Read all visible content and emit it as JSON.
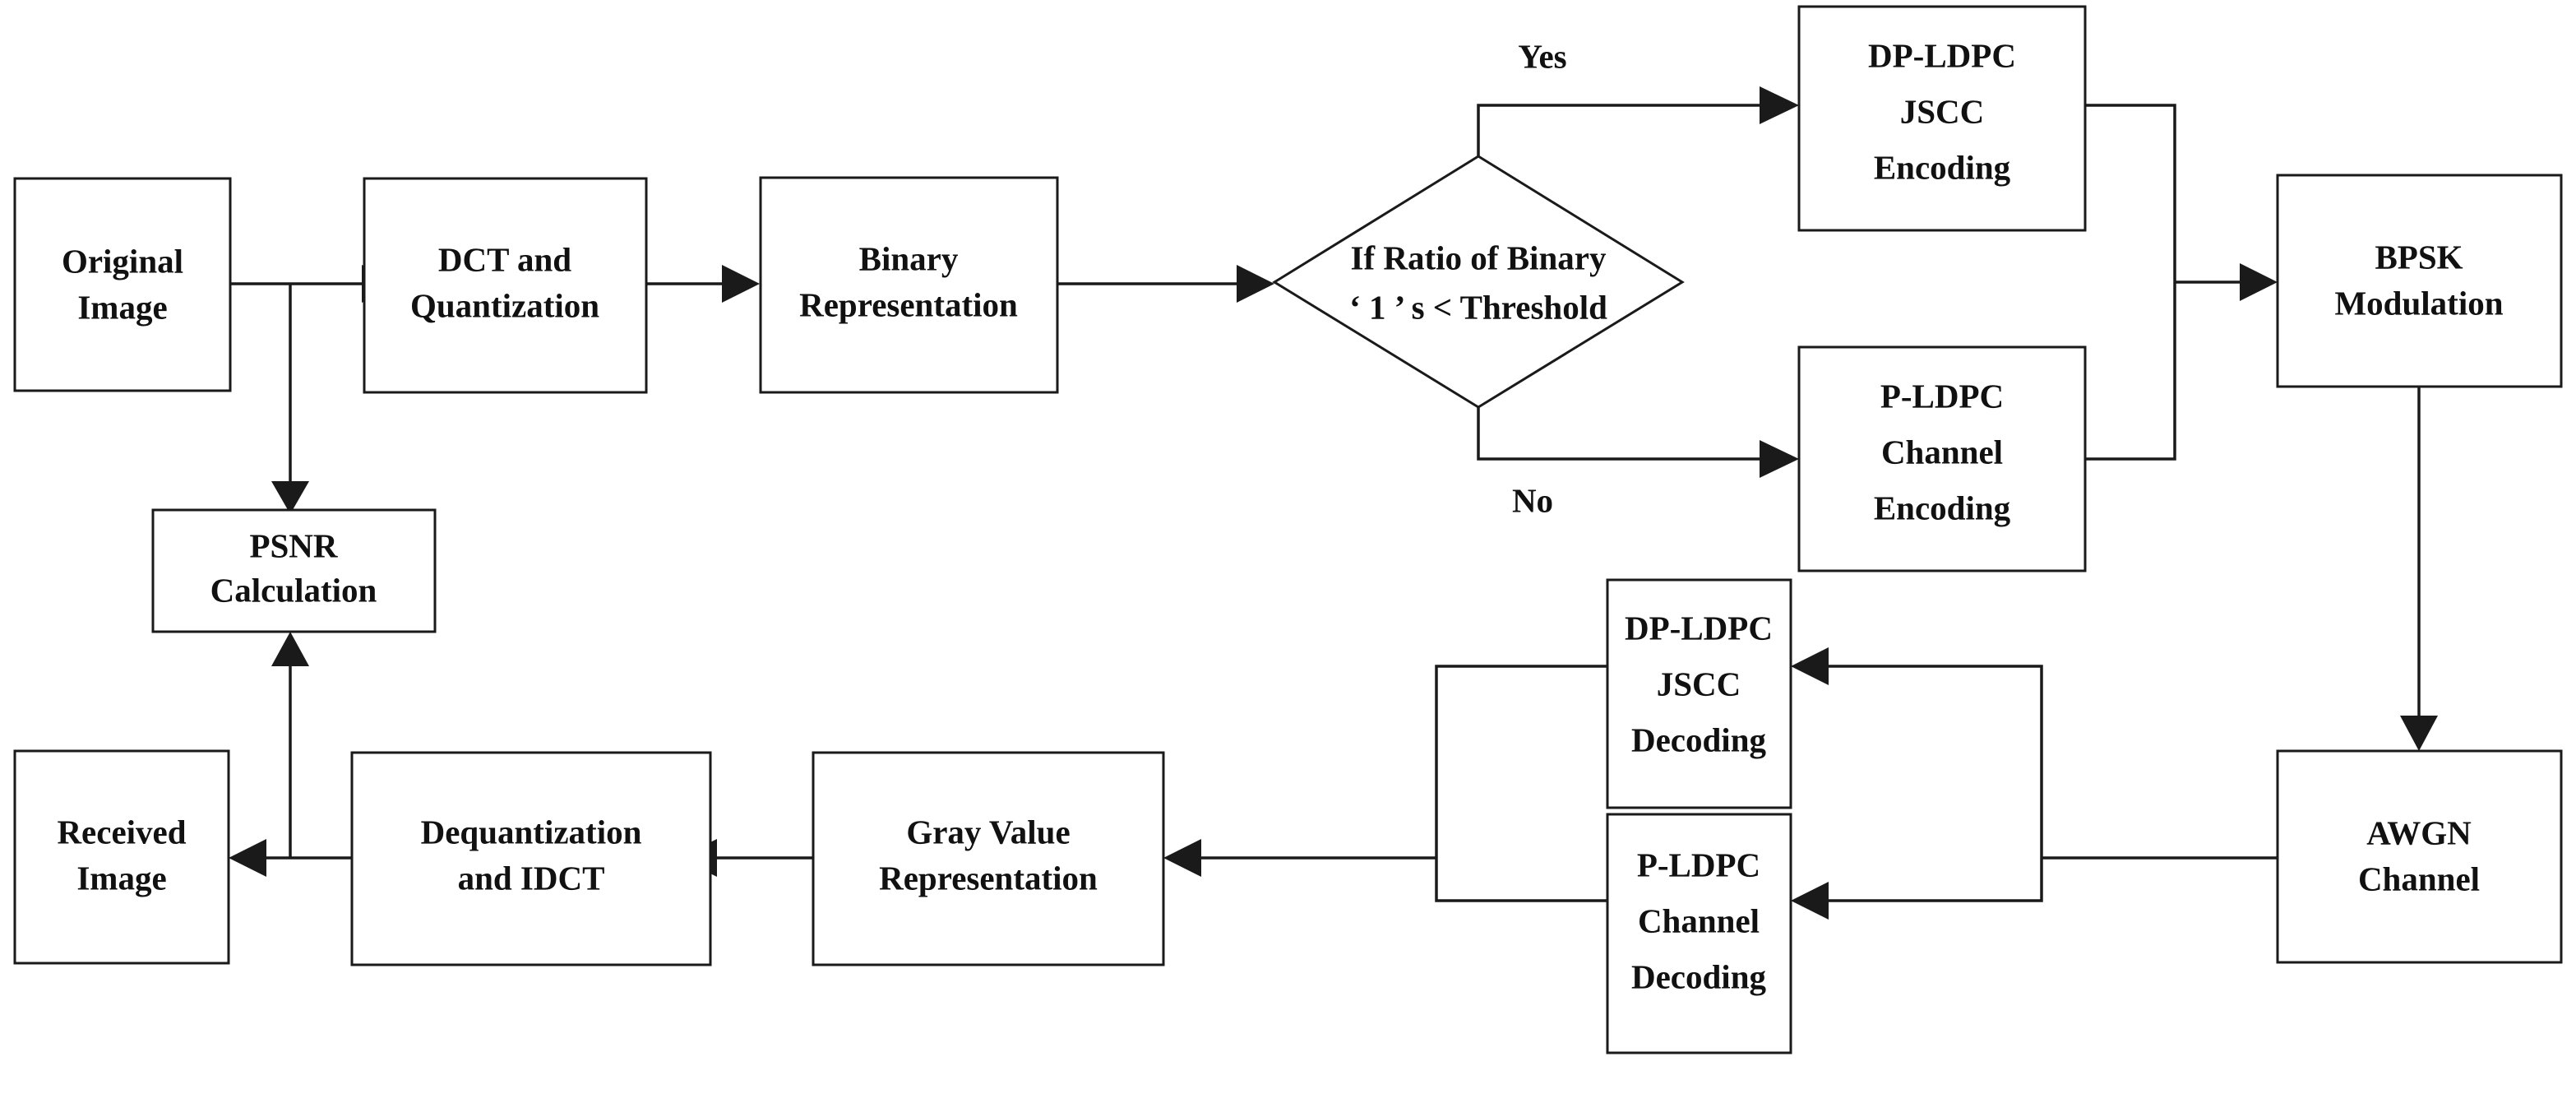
{
  "diagram": {
    "title": "JSCC image transmission system flowchart",
    "colors": {
      "stroke": "#1a1a1a",
      "fill": "#ffffff",
      "text": "#111111"
    },
    "nodes": [
      {
        "id": "original-image",
        "shape": "rect",
        "lines": [
          "Original",
          "Image"
        ],
        "line1": "Original",
        "line2": "Image",
        "line3": ""
      },
      {
        "id": "dct-quantization",
        "shape": "rect",
        "lines": [
          "DCT and",
          "Quantization"
        ],
        "line1": "DCT and",
        "line2": "Quantization",
        "line3": ""
      },
      {
        "id": "binary-representation",
        "shape": "rect",
        "lines": [
          "Binary",
          "Representation"
        ],
        "line1": "Binary",
        "line2": "Representation",
        "line3": ""
      },
      {
        "id": "threshold-decision",
        "shape": "diamond",
        "lines": [
          "If Ratio of Binary",
          "‘ 1 ’  s < Threshold"
        ],
        "line1": "If Ratio of Binary",
        "line2": "‘ 1 ’  s < Threshold",
        "line3": ""
      },
      {
        "id": "dp-ldpc-jscc-encoding",
        "shape": "rect",
        "lines": [
          "DP-LDPC",
          "JSCC",
          "Encoding"
        ],
        "line1": "DP-LDPC",
        "line2": "JSCC",
        "line3": "Encoding"
      },
      {
        "id": "p-ldpc-channel-encoding",
        "shape": "rect",
        "lines": [
          "P-LDPC",
          "Channel",
          "Encoding"
        ],
        "line1": "P-LDPC",
        "line2": "Channel",
        "line3": "Encoding"
      },
      {
        "id": "bpsk-modulation",
        "shape": "rect",
        "lines": [
          "BPSK",
          "Modulation"
        ],
        "line1": "BPSK",
        "line2": "Modulation",
        "line3": ""
      },
      {
        "id": "awgn-channel",
        "shape": "rect",
        "lines": [
          "AWGN",
          "Channel"
        ],
        "line1": "AWGN",
        "line2": "Channel",
        "line3": ""
      },
      {
        "id": "dp-ldpc-jscc-decoding",
        "shape": "rect",
        "lines": [
          "DP-LDPC",
          "JSCC",
          "Decoding"
        ],
        "line1": "DP-LDPC",
        "line2": "JSCC",
        "line3": "Decoding"
      },
      {
        "id": "p-ldpc-channel-decoding",
        "shape": "rect",
        "lines": [
          "P-LDPC",
          "Channel",
          "Decoding"
        ],
        "line1": "P-LDPC",
        "line2": "Channel",
        "line3": "Decoding"
      },
      {
        "id": "gray-value-representation",
        "shape": "rect",
        "lines": [
          "Gray Value",
          "Representation"
        ],
        "line1": "Gray Value",
        "line2": "Representation",
        "line3": ""
      },
      {
        "id": "dequantization-idct",
        "shape": "rect",
        "lines": [
          "Dequantization",
          "and IDCT"
        ],
        "line1": "Dequantization",
        "line2": "and IDCT",
        "line3": ""
      },
      {
        "id": "received-image",
        "shape": "rect",
        "lines": [
          "Received",
          "Image"
        ],
        "line1": "Received",
        "line2": "Image",
        "line3": ""
      },
      {
        "id": "psnr-calculation",
        "shape": "rect",
        "lines": [
          "PSNR",
          "Calculation"
        ],
        "line1": "PSNR",
        "line2": "Calculation",
        "line3": ""
      }
    ],
    "edge_labels": {
      "yes": "Yes",
      "no": "No"
    }
  }
}
